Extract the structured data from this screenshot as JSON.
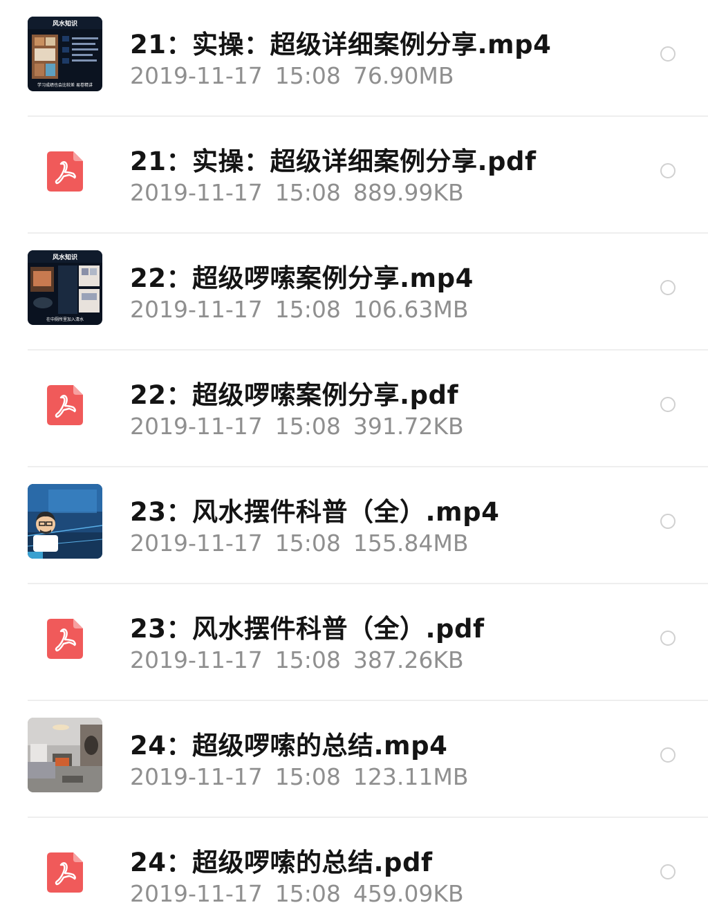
{
  "files": [
    {
      "name": "21：实操：超级详细案例分享.mp4",
      "date": "2019-11-17",
      "time": "15:08",
      "size": "76.90MB",
      "type": "video",
      "thumb_title": "风水知识",
      "thumb_caption": "学习成绩也会比较差 易卷精讲"
    },
    {
      "name": "21：实操：超级详细案例分享.pdf",
      "date": "2019-11-17",
      "time": "15:08",
      "size": "889.99KB",
      "type": "pdf"
    },
    {
      "name": "22：超级啰嗦案例分享.mp4",
      "date": "2019-11-17",
      "time": "15:08",
      "size": "106.63MB",
      "type": "video",
      "thumb_title": "风水知识",
      "thumb_caption": "在中厕所里加入清水"
    },
    {
      "name": "22：超级啰嗦案例分享.pdf",
      "date": "2019-11-17",
      "time": "15:08",
      "size": "391.72KB",
      "type": "pdf"
    },
    {
      "name": "23：风水摆件科普（全）.mp4",
      "date": "2019-11-17",
      "time": "15:08",
      "size": "155.84MB",
      "type": "video"
    },
    {
      "name": "23：风水摆件科普（全）.pdf",
      "date": "2019-11-17",
      "time": "15:08",
      "size": "387.26KB",
      "type": "pdf"
    },
    {
      "name": "24：超级啰嗦的总结.mp4",
      "date": "2019-11-17",
      "time": "15:08",
      "size": "123.11MB",
      "type": "video"
    },
    {
      "name": "24：超级啰嗦的总结.pdf",
      "date": "2019-11-17",
      "time": "15:08",
      "size": "459.09KB",
      "type": "pdf"
    }
  ],
  "icons": {
    "pdf": "pdf-file-icon",
    "select": "radio-circle-icon"
  },
  "colors": {
    "pdf_red": "#f05a5a",
    "title": "#141414",
    "meta": "#8f8f8f",
    "divider": "#eeeeee",
    "circle": "#d0d0d0"
  }
}
